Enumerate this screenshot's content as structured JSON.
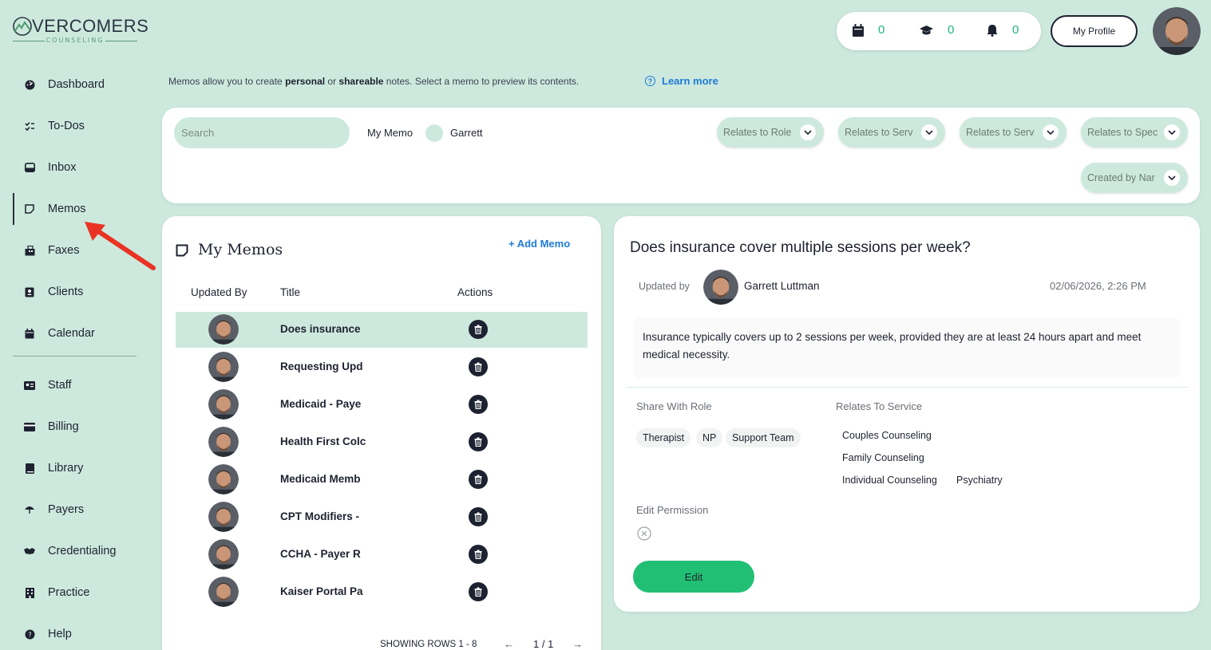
{
  "logo": {
    "main": "VERCOMERS",
    "sub": "COUNSELING"
  },
  "sidebar": {
    "items": [
      {
        "label": "Dashboard",
        "icon": "dashboard-icon"
      },
      {
        "label": "To-Dos",
        "icon": "checklist-icon"
      },
      {
        "label": "Inbox",
        "icon": "inbox-icon"
      },
      {
        "label": "Memos",
        "icon": "memo-icon",
        "active": true
      },
      {
        "label": "Faxes",
        "icon": "fax-icon"
      },
      {
        "label": "Clients",
        "icon": "clients-icon"
      },
      {
        "label": "Calendar",
        "icon": "calendar-icon"
      },
      {
        "label": "Staff",
        "icon": "staff-icon"
      },
      {
        "label": "Billing",
        "icon": "billing-icon"
      },
      {
        "label": "Library",
        "icon": "library-icon"
      },
      {
        "label": "Payers",
        "icon": "payers-icon"
      },
      {
        "label": "Credentialing",
        "icon": "handshake-icon"
      },
      {
        "label": "Practice",
        "icon": "building-icon"
      },
      {
        "label": "Help",
        "icon": "help-icon"
      }
    ]
  },
  "header": {
    "counters": [
      {
        "icon": "calendar-icon",
        "value": "0"
      },
      {
        "icon": "graduation-cap-icon",
        "value": "0"
      },
      {
        "icon": "bell-icon",
        "value": "0"
      }
    ],
    "profile_label": "My Profile"
  },
  "info": {
    "text_1": "Memos allow you to create ",
    "bold_1": "personal",
    "text_2": " or ",
    "bold_2": "shareable",
    "text_3": " notes.   Select a memo to preview its contents.",
    "learn_more": "Learn more"
  },
  "filters": {
    "search_placeholder": "Search",
    "toggle_left": "My Memo",
    "toggle_right": "Garrett",
    "dropdowns": [
      "Relates to Role",
      "Relates to Serv",
      "Relates to Serv",
      "Relates to Spec",
      "Created by Nar"
    ]
  },
  "memos": {
    "title": "My Memos",
    "add_label": "+ Add Memo",
    "columns": {
      "updated_by": "Updated By",
      "title": "Title",
      "actions": "Actions"
    },
    "rows": [
      {
        "title": "Does insurance"
      },
      {
        "title": "Requesting Upd"
      },
      {
        "title": "Medicaid - Paye"
      },
      {
        "title": "Health First Colc"
      },
      {
        "title": "Medicaid Memb"
      },
      {
        "title": "CPT Modifiers -"
      },
      {
        "title": "CCHA - Payer R"
      },
      {
        "title": "Kaiser Portal Pa"
      }
    ],
    "footer": "SHOWING ROWS 1 - 8",
    "page": "1 / 1",
    "prev": "←",
    "next": "→"
  },
  "detail": {
    "title": "Does insurance cover multiple sessions per week?",
    "updated_by_label": "Updated by",
    "updated_by_name": "Garrett Luttman",
    "date": "02/06/2026, 2:26 PM",
    "body": "Insurance typically covers up to 2 sessions per week, provided they are at least 24 hours apart and meet medical necessity.",
    "share_label": "Share With Role",
    "roles": [
      "Therapist",
      "NP",
      "Support Team"
    ],
    "relates_label": "Relates To Service",
    "services": [
      "Couples Counseling",
      "Family Counseling",
      "Individual Counseling",
      "Psychiatry"
    ],
    "edit_permission_label": "Edit Permission",
    "edit_button": "Edit"
  },
  "colors": {
    "accent_green": "#21bf73",
    "bg_mint": "#cde9dd",
    "link_blue": "#1e7ad8",
    "arrow_red": "#ea3323"
  }
}
